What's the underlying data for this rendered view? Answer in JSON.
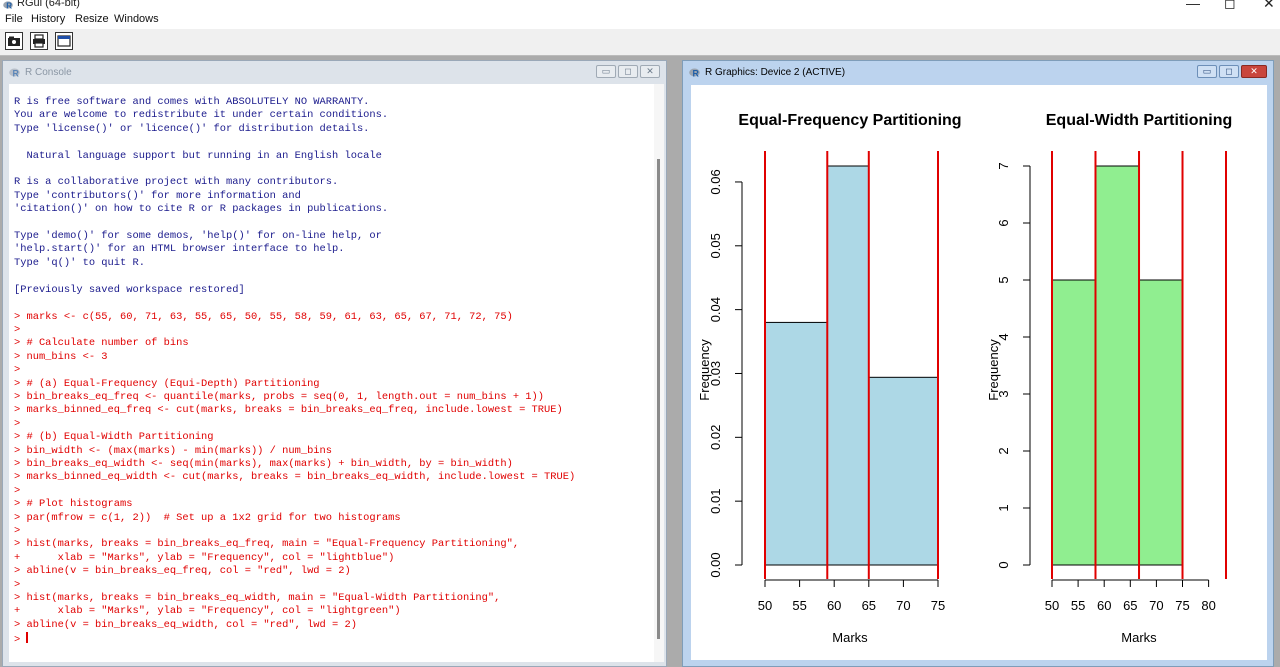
{
  "app": {
    "title": "RGui (64-bit)",
    "window_controls": {
      "minimize": "—",
      "maximize": "◻",
      "close": "✕"
    }
  },
  "menu": [
    "File",
    "History",
    "Resize",
    "Windows"
  ],
  "toolbar": {
    "buttons": [
      {
        "name": "open-script",
        "icon": "folder-icon"
      },
      {
        "name": "print",
        "icon": "print-icon"
      },
      {
        "name": "console",
        "icon": "window-icon"
      }
    ]
  },
  "console": {
    "title": "R Console",
    "controls": {
      "minimize": "▭",
      "maximize": "◻",
      "close": "✕"
    },
    "lines": [
      {
        "text": "R is free software and comes with ABSOLUTELY NO WARRANTY.",
        "c": "blue"
      },
      {
        "text": "You are welcome to redistribute it under certain conditions.",
        "c": "blue"
      },
      {
        "text": "Type 'license()' or 'licence()' for distribution details.",
        "c": "blue"
      },
      {
        "text": "",
        "c": "blue"
      },
      {
        "text": "  Natural language support but running in an English locale",
        "c": "blue"
      },
      {
        "text": "",
        "c": "blue"
      },
      {
        "text": "R is a collaborative project with many contributors.",
        "c": "blue"
      },
      {
        "text": "Type 'contributors()' for more information and",
        "c": "blue"
      },
      {
        "text": "'citation()' on how to cite R or R packages in publications.",
        "c": "blue"
      },
      {
        "text": "",
        "c": "blue"
      },
      {
        "text": "Type 'demo()' for some demos, 'help()' for on-line help, or",
        "c": "blue"
      },
      {
        "text": "'help.start()' for an HTML browser interface to help.",
        "c": "blue"
      },
      {
        "text": "Type 'q()' to quit R.",
        "c": "blue"
      },
      {
        "text": "",
        "c": "blue"
      },
      {
        "text": "[Previously saved workspace restored]",
        "c": "blue"
      },
      {
        "text": "",
        "c": "blue"
      },
      {
        "text": "> marks <- c(55, 60, 71, 63, 55, 65, 50, 55, 58, 59, 61, 63, 65, 67, 71, 72, 75)",
        "c": "red"
      },
      {
        "text": ">",
        "c": "red"
      },
      {
        "text": "> # Calculate number of bins",
        "c": "red"
      },
      {
        "text": "> num_bins <- 3",
        "c": "red"
      },
      {
        "text": ">",
        "c": "red"
      },
      {
        "text": "> # (a) Equal-Frequency (Equi-Depth) Partitioning",
        "c": "red"
      },
      {
        "text": "> bin_breaks_eq_freq <- quantile(marks, probs = seq(0, 1, length.out = num_bins + 1))",
        "c": "red"
      },
      {
        "text": "> marks_binned_eq_freq <- cut(marks, breaks = bin_breaks_eq_freq, include.lowest = TRUE)",
        "c": "red"
      },
      {
        "text": ">",
        "c": "red"
      },
      {
        "text": "> # (b) Equal-Width Partitioning",
        "c": "red"
      },
      {
        "text": "> bin_width <- (max(marks) - min(marks)) / num_bins",
        "c": "red"
      },
      {
        "text": "> bin_breaks_eq_width <- seq(min(marks), max(marks) + bin_width, by = bin_width)",
        "c": "red"
      },
      {
        "text": "> marks_binned_eq_width <- cut(marks, breaks = bin_breaks_eq_width, include.lowest = TRUE)",
        "c": "red"
      },
      {
        "text": ">",
        "c": "red"
      },
      {
        "text": "> # Plot histograms",
        "c": "red"
      },
      {
        "text": "> par(mfrow = c(1, 2))  # Set up a 1x2 grid for two histograms",
        "c": "red"
      },
      {
        "text": ">",
        "c": "red"
      },
      {
        "text": "> hist(marks, breaks = bin_breaks_eq_freq, main = \"Equal-Frequency Partitioning\",",
        "c": "red"
      },
      {
        "text": "+      xlab = \"Marks\", ylab = \"Frequency\", col = \"lightblue\")",
        "c": "red"
      },
      {
        "text": "> abline(v = bin_breaks_eq_freq, col = \"red\", lwd = 2)",
        "c": "red"
      },
      {
        "text": ">",
        "c": "red"
      },
      {
        "text": "> hist(marks, breaks = bin_breaks_eq_width, main = \"Equal-Width Partitioning\",",
        "c": "red"
      },
      {
        "text": "+      xlab = \"Marks\", ylab = \"Frequency\", col = \"lightgreen\")",
        "c": "red"
      },
      {
        "text": "> abline(v = bin_breaks_eq_width, col = \"red\", lwd = 2)",
        "c": "red"
      }
    ],
    "prompt": "> "
  },
  "graphics": {
    "title": "R Graphics: Device 2 (ACTIVE)",
    "controls": {
      "minimize": "▭",
      "maximize": "◻",
      "close": "✕"
    }
  },
  "colors": {
    "bar1": "#add8e6",
    "bar2": "#90ee90",
    "abline": "#e00000",
    "console_blue": "#1a1a8c",
    "console_red": "#e00000"
  },
  "chart_data": [
    {
      "type": "bar",
      "title": "Equal-Frequency Partitioning",
      "xlabel": "Marks",
      "ylabel": "Frequency",
      "bins": [
        {
          "from": 50,
          "to": 59,
          "value": 0.038
        },
        {
          "from": 59,
          "to": 65,
          "value": 0.0625
        },
        {
          "from": 65,
          "to": 75,
          "value": 0.0294
        }
      ],
      "xlim": [
        50,
        75
      ],
      "ylim": [
        0,
        0.0625
      ],
      "xticks": [
        50,
        55,
        60,
        65,
        70,
        75
      ],
      "yticks": [
        0.0,
        0.01,
        0.02,
        0.03,
        0.04,
        0.05,
        0.06
      ],
      "ytick_labels": [
        "0.00",
        "0.01",
        "0.02",
        "0.03",
        "0.04",
        "0.05",
        "0.06"
      ],
      "vlines": [
        50,
        59,
        65,
        75
      ],
      "fill": "#add8e6"
    },
    {
      "type": "bar",
      "title": "Equal-Width Partitioning",
      "xlabel": "Marks",
      "ylabel": "Frequency",
      "bins": [
        {
          "from": 50,
          "to": 58.33,
          "value": 5
        },
        {
          "from": 58.33,
          "to": 66.67,
          "value": 7
        },
        {
          "from": 66.67,
          "to": 75,
          "value": 5
        },
        {
          "from": 75,
          "to": 83.33,
          "value": 0
        }
      ],
      "xlim": [
        50,
        83.33
      ],
      "ylim": [
        0,
        7
      ],
      "xticks": [
        50,
        55,
        60,
        65,
        70,
        75,
        80
      ],
      "yticks": [
        0,
        1,
        2,
        3,
        4,
        5,
        6,
        7
      ],
      "ytick_labels": [
        "0",
        "1",
        "2",
        "3",
        "4",
        "5",
        "6",
        "7"
      ],
      "vlines": [
        50,
        58.33,
        66.67,
        75,
        83.33
      ],
      "fill": "#90ee90"
    }
  ]
}
